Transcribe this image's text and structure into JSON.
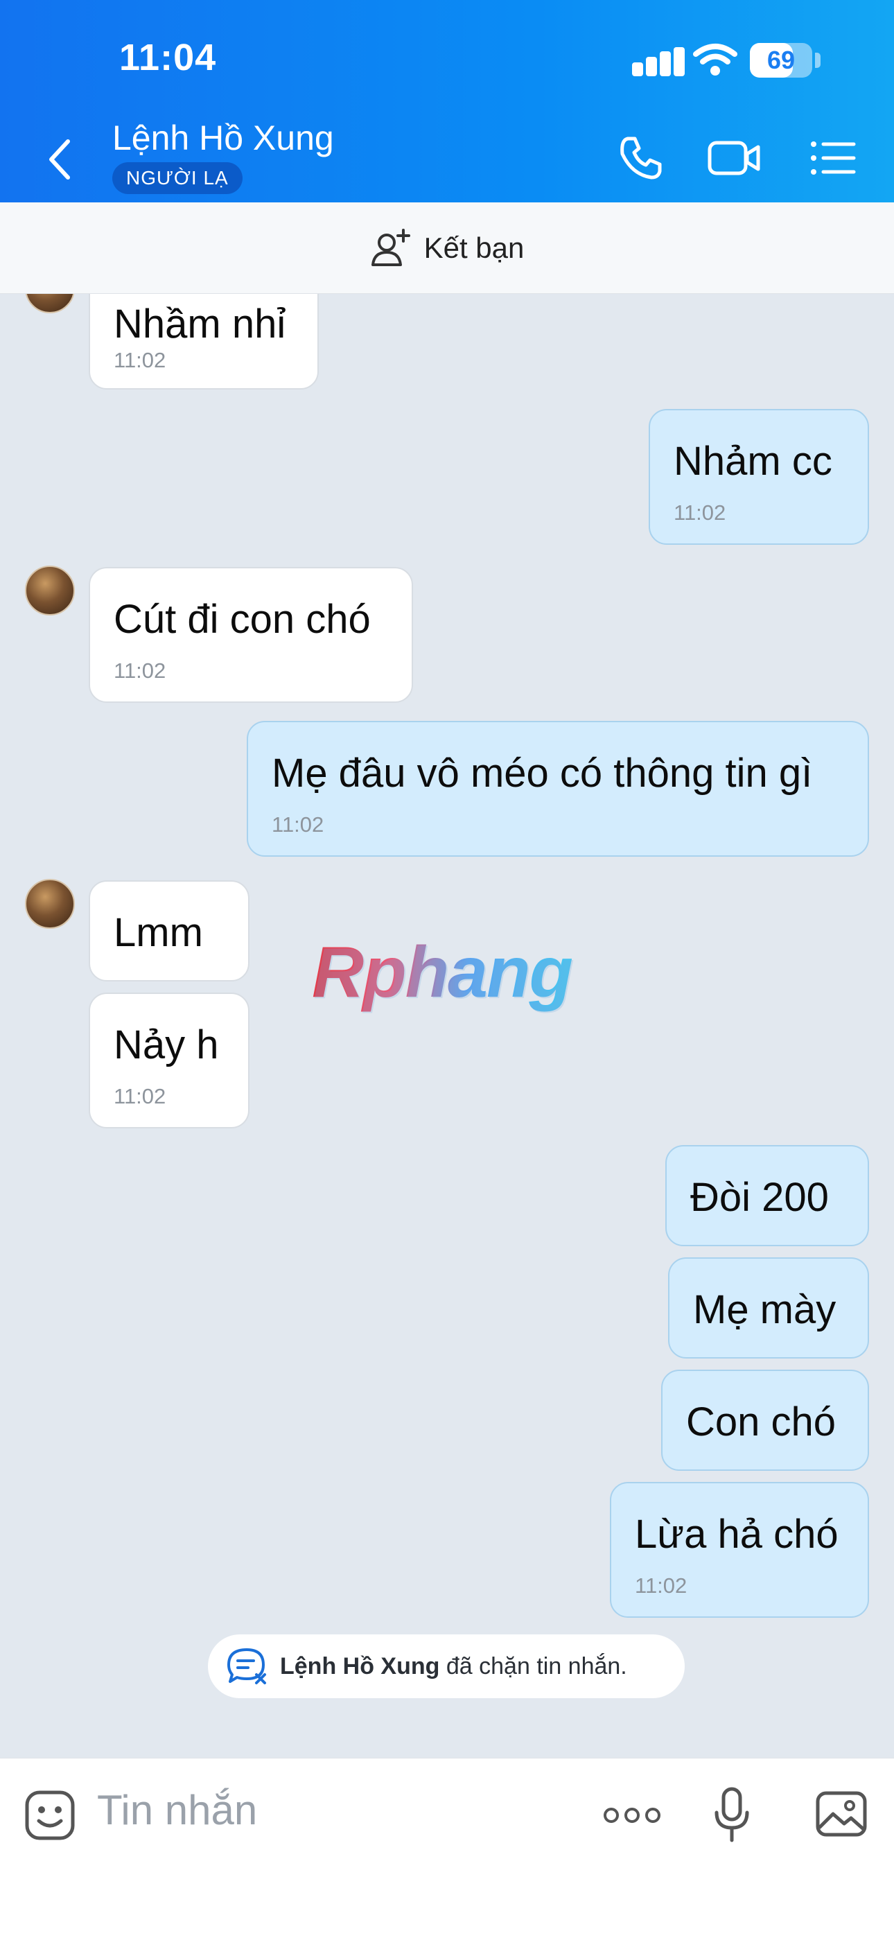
{
  "status_bar": {
    "time": "11:04",
    "battery": "69",
    "battery_level": 0.69
  },
  "header": {
    "contact_name": "Lệnh Hồ Xung",
    "badge": "NGƯỜI LẠ",
    "icons": [
      "back-icon",
      "phone-icon",
      "video-call-icon",
      "menu-list-icon"
    ]
  },
  "friend_bar": {
    "label": "Kết bạn",
    "icon": "add-friend-icon"
  },
  "messages": [
    {
      "side": "in",
      "text": "Nhầm nhỉ",
      "time": "11:02"
    },
    {
      "side": "out",
      "text": "Nhảm cc",
      "time": "11:02"
    },
    {
      "side": "in",
      "text": "Cút đi con chó",
      "time": "11:02"
    },
    {
      "side": "out",
      "text": "Mẹ đâu vô méo có thông tin gì",
      "time": "11:02"
    },
    {
      "side": "in",
      "text": "Lmm",
      "time": ""
    },
    {
      "side": "in",
      "text": "Nảy h",
      "time": "11:02"
    },
    {
      "side": "out",
      "text": "Đòi 200",
      "time": ""
    },
    {
      "side": "out",
      "text": "Mẹ mày",
      "time": ""
    },
    {
      "side": "out",
      "text": "Con chó",
      "time": ""
    },
    {
      "side": "out",
      "text": "Lừa hả chó",
      "time": "11:02"
    }
  ],
  "watermark": "Rphang",
  "blocked_notice": {
    "name": "Lệnh Hồ Xung",
    "text": "đã chặn tin nhắn."
  },
  "input_bar": {
    "placeholder": "Tin nhắn",
    "icons": [
      "emoji-icon",
      "more-icon",
      "microphone-icon",
      "image-icon"
    ]
  },
  "colors": {
    "header_blue": "#0a8cf4",
    "outgoing_bubble": "#d3ecfd",
    "incoming_bubble": "#ffffff",
    "chat_background": "#e2e8ef"
  }
}
